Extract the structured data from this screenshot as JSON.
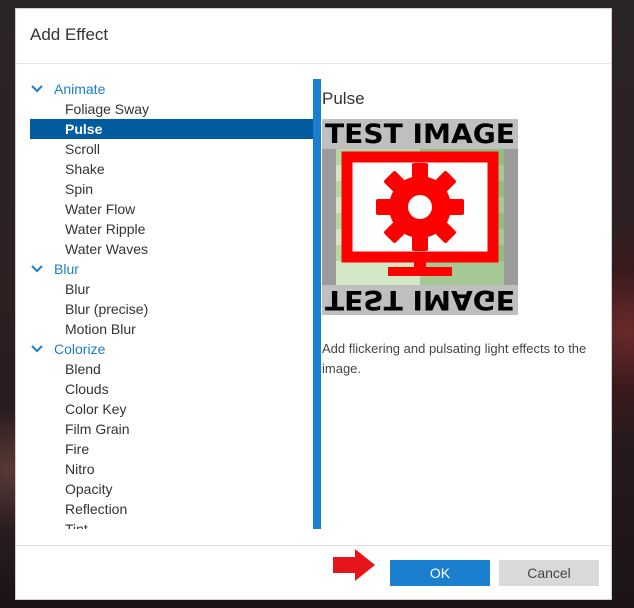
{
  "dialog": {
    "title": "Add Effect"
  },
  "tree": [
    {
      "type": "category",
      "label": "Animate"
    },
    {
      "type": "child",
      "label": "Foliage Sway"
    },
    {
      "type": "child",
      "label": "Pulse",
      "selected": true
    },
    {
      "type": "child",
      "label": "Scroll"
    },
    {
      "type": "child",
      "label": "Shake"
    },
    {
      "type": "child",
      "label": "Spin"
    },
    {
      "type": "child",
      "label": "Water Flow"
    },
    {
      "type": "child",
      "label": "Water Ripple"
    },
    {
      "type": "child",
      "label": "Water Waves"
    },
    {
      "type": "category",
      "label": "Blur"
    },
    {
      "type": "child",
      "label": "Blur"
    },
    {
      "type": "child",
      "label": "Blur (precise)"
    },
    {
      "type": "child",
      "label": "Motion Blur"
    },
    {
      "type": "category",
      "label": "Colorize"
    },
    {
      "type": "child",
      "label": "Blend"
    },
    {
      "type": "child",
      "label": "Clouds"
    },
    {
      "type": "child",
      "label": "Color Key"
    },
    {
      "type": "child",
      "label": "Film Grain"
    },
    {
      "type": "child",
      "label": "Fire"
    },
    {
      "type": "child",
      "label": "Nitro"
    },
    {
      "type": "child",
      "label": "Opacity"
    },
    {
      "type": "child",
      "label": "Reflection"
    },
    {
      "type": "child",
      "label": "Tint"
    }
  ],
  "detail": {
    "title": "Pulse",
    "preview_text_top": "TEST IMAGE",
    "preview_text_bottom": "TEST IMAGE",
    "description": "Add flickering and pulsating light effects to the image."
  },
  "buttons": {
    "ok": "OK",
    "cancel": "Cancel"
  },
  "colors": {
    "accent": "#1a7fcf",
    "selected_bg": "#005b9f",
    "category_text": "#1a7fc5",
    "arrow": "#e8141b",
    "preview_red": "#ff0000"
  },
  "icons": {
    "category_expanded": "chevron-down-icon",
    "ok_pointer": "red-arrow-icon"
  }
}
